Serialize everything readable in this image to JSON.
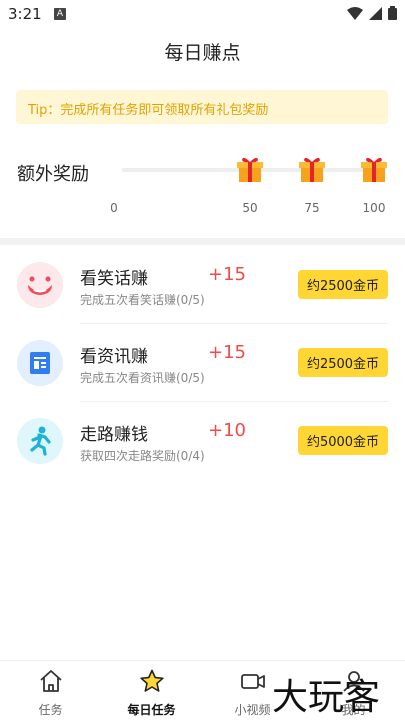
{
  "status_bar": {
    "time": "3:21",
    "notification_badge": "A"
  },
  "header": {
    "title": "每日赚点"
  },
  "tip": {
    "text": "Tip：完成所有任务即可领取所有礼包奖励"
  },
  "reward": {
    "label": "额外奖励",
    "ticks": [
      "0",
      "50",
      "75",
      "100"
    ],
    "gift_color": "#f7a21b"
  },
  "tasks": [
    {
      "title": "看笑话赚",
      "points": "+15",
      "desc": "完成五次看笑话赚(0/5)",
      "button": "约2500金币",
      "icon": "smile-icon",
      "icon_bg": "#fde8ec",
      "icon_color": "#f04b5a"
    },
    {
      "title": "看资讯赚",
      "points": "+15",
      "desc": "完成五次看资讯赚(0/5)",
      "button": "约2500金币",
      "icon": "news-icon",
      "icon_bg": "#e3efff",
      "icon_color": "#2f7df0"
    },
    {
      "title": "走路赚钱",
      "points": "+10",
      "desc": "获取四次走路奖励(0/4)",
      "button": "约5000金币",
      "icon": "walk-icon",
      "icon_bg": "#dff6fb",
      "icon_color": "#1cb3d6"
    }
  ],
  "tabs": [
    {
      "label": "任务",
      "icon": "home-icon",
      "active": false
    },
    {
      "label": "每日任务",
      "icon": "star-icon",
      "active": true
    },
    {
      "label": "小视频",
      "icon": "video-icon",
      "active": false
    },
    {
      "label": "我的",
      "icon": "profile-icon",
      "active": false
    }
  ],
  "watermark": {
    "text": "大玩客"
  },
  "colors": {
    "accent_yellow": "#ffd633",
    "points_red": "#ee4b4b",
    "tip_text": "#e0a300",
    "tip_bg": "#fff6d6"
  }
}
